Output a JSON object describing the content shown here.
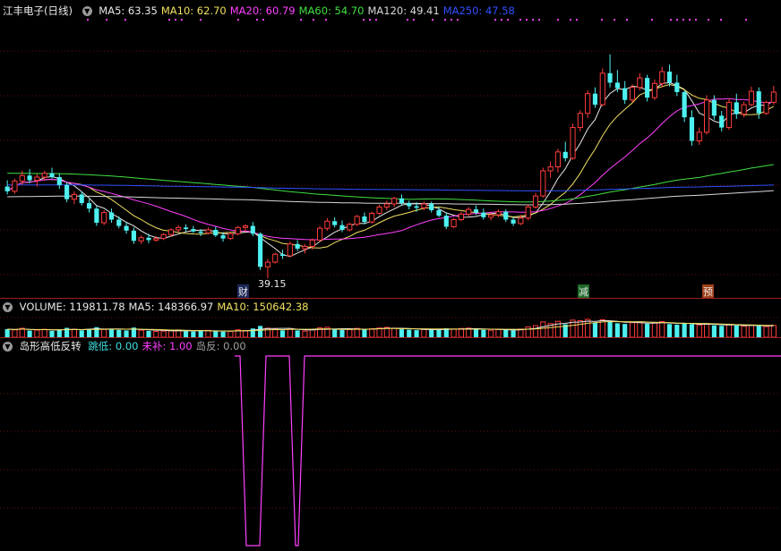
{
  "stock": {
    "name": "江丰电子",
    "period": "(日线)"
  },
  "price_legend": [
    {
      "label": "MA5:",
      "value": "63.35",
      "color": "#e8e8e8"
    },
    {
      "label": "MA10:",
      "value": "62.70",
      "color": "#f0e060"
    },
    {
      "label": "MA20:",
      "value": "60.79",
      "color": "#ff40ff"
    },
    {
      "label": "MA60:",
      "value": "54.70",
      "color": "#40e040"
    },
    {
      "label": "MA120:",
      "value": "49.41",
      "color": "#d8d8d8"
    },
    {
      "label": "MA250:",
      "value": "47.58",
      "color": "#3050ff"
    }
  ],
  "annotations": {
    "low_price": "39.15",
    "marker_cai": "财",
    "marker_jian": "减",
    "marker_yu": "预"
  },
  "volume_legend": [
    {
      "label": "VOLUME:",
      "value": "119811.78",
      "color": "#e8e8e8"
    },
    {
      "label": "MA5:",
      "value": "148366.97",
      "color": "#e8e8e8"
    },
    {
      "label": "MA10:",
      "value": "150642.38",
      "color": "#f0e060"
    }
  ],
  "indicator_legend": {
    "name": "岛形高低反转",
    "items": [
      {
        "label": "跳低:",
        "value": "0.00",
        "color": "#40e0e0"
      },
      {
        "label": "未补:",
        "value": "1.00",
        "color": "#ff40ff"
      },
      {
        "label": "岛反:",
        "value": "0.00",
        "color": "#a0a0a0"
      }
    ]
  },
  "colors": {
    "up": "#ff3c3c",
    "down": "#4ef0f0",
    "grid": "#6a1010",
    "panel_border": "#a02020"
  },
  "chart_data": [
    {
      "type": "candlestick",
      "title": "江丰电子 (日线)",
      "ylim": [
        37,
        72
      ],
      "series_names": [
        "MA5",
        "MA10",
        "MA20",
        "MA60",
        "MA120",
        "MA250"
      ],
      "candles": [
        [
          50.8,
          51.6,
          49.8,
          50.2
        ],
        [
          50.2,
          51.8,
          49.9,
          51.5
        ],
        [
          51.5,
          52.8,
          51.0,
          52.2
        ],
        [
          52.2,
          53.0,
          51.2,
          51.6
        ],
        [
          51.6,
          52.4,
          50.8,
          52.0
        ],
        [
          52.0,
          52.8,
          51.5,
          52.5
        ],
        [
          52.5,
          53.2,
          51.8,
          52.0
        ],
        [
          52.0,
          52.5,
          50.5,
          51.0
        ],
        [
          51.0,
          51.3,
          48.8,
          49.2
        ],
        [
          49.2,
          50.2,
          48.6,
          49.8
        ],
        [
          49.8,
          50.2,
          48.4,
          48.7
        ],
        [
          48.7,
          49.2,
          47.5,
          48.0
        ],
        [
          48.0,
          48.3,
          45.8,
          46.2
        ],
        [
          46.2,
          47.8,
          45.9,
          47.5
        ],
        [
          47.5,
          48.0,
          46.2,
          46.6
        ],
        [
          46.6,
          47.0,
          45.5,
          45.8
        ],
        [
          45.8,
          46.2,
          44.8,
          45.2
        ],
        [
          45.2,
          45.6,
          43.5,
          43.9
        ],
        [
          43.9,
          44.6,
          43.5,
          44.3
        ],
        [
          44.3,
          44.8,
          43.6,
          44.0
        ],
        [
          44.0,
          44.5,
          43.8,
          44.2
        ],
        [
          44.2,
          44.9,
          44.0,
          44.7
        ],
        [
          44.7,
          45.5,
          44.4,
          45.3
        ],
        [
          45.3,
          45.9,
          45.0,
          45.6
        ],
        [
          45.6,
          46.0,
          45.1,
          45.4
        ],
        [
          45.4,
          45.8,
          44.9,
          45.1
        ],
        [
          45.1,
          45.4,
          44.5,
          44.9
        ],
        [
          44.9,
          45.6,
          44.7,
          45.3
        ],
        [
          45.3,
          45.7,
          44.4,
          44.6
        ],
        [
          44.6,
          45.0,
          43.8,
          44.2
        ],
        [
          44.2,
          45.0,
          44.0,
          44.8
        ],
        [
          44.8,
          45.8,
          44.6,
          45.6
        ],
        [
          45.6,
          46.0,
          45.1,
          45.8
        ],
        [
          45.8,
          46.3,
          44.5,
          44.8
        ],
        [
          44.8,
          45.0,
          40.2,
          40.6
        ],
        [
          40.6,
          41.6,
          39.15,
          41.2
        ],
        [
          41.2,
          42.4,
          41.0,
          42.2
        ],
        [
          42.2,
          42.8,
          41.6,
          42.0
        ],
        [
          42.0,
          43.8,
          41.8,
          43.5
        ],
        [
          43.5,
          44.0,
          42.6,
          42.9
        ],
        [
          42.9,
          43.5,
          42.3,
          43.2
        ],
        [
          43.2,
          44.2,
          42.8,
          44.0
        ],
        [
          44.0,
          45.8,
          43.8,
          45.5
        ],
        [
          45.5,
          46.8,
          45.2,
          46.4
        ],
        [
          46.4,
          46.9,
          45.6,
          45.9
        ],
        [
          45.9,
          46.5,
          45.0,
          45.3
        ],
        [
          45.3,
          46.2,
          45.1,
          46.0
        ],
        [
          46.0,
          47.2,
          45.8,
          47.0
        ],
        [
          47.0,
          47.5,
          46.0,
          46.3
        ],
        [
          46.3,
          47.6,
          46.1,
          47.4
        ],
        [
          47.4,
          48.5,
          47.2,
          48.2
        ],
        [
          48.2,
          49.0,
          47.8,
          48.6
        ],
        [
          48.6,
          49.5,
          48.2,
          49.3
        ],
        [
          49.3,
          49.8,
          48.4,
          48.7
        ],
        [
          48.7,
          49.0,
          47.9,
          48.3
        ],
        [
          48.3,
          48.8,
          47.6,
          48.1
        ],
        [
          48.1,
          48.9,
          47.8,
          48.6
        ],
        [
          48.6,
          48.9,
          47.5,
          47.8
        ],
        [
          47.8,
          48.2,
          46.9,
          47.1
        ],
        [
          47.1,
          47.5,
          45.4,
          45.7
        ],
        [
          45.7,
          46.8,
          45.5,
          46.6
        ],
        [
          46.6,
          47.6,
          46.4,
          47.3
        ],
        [
          47.3,
          48.2,
          47.0,
          47.9
        ],
        [
          47.9,
          48.4,
          47.2,
          47.5
        ],
        [
          47.5,
          48.0,
          46.6,
          46.9
        ],
        [
          46.9,
          47.4,
          46.5,
          47.2
        ],
        [
          47.2,
          47.9,
          46.9,
          47.6
        ],
        [
          47.6,
          47.9,
          46.3,
          46.6
        ],
        [
          46.6,
          46.9,
          45.8,
          46.1
        ],
        [
          46.1,
          47.2,
          45.9,
          46.8
        ],
        [
          46.8,
          48.5,
          46.5,
          48.2
        ],
        [
          48.2,
          50.0,
          48.0,
          49.6
        ],
        [
          49.6,
          53.2,
          49.4,
          52.8
        ],
        [
          52.8,
          54.0,
          51.9,
          53.3
        ],
        [
          53.3,
          55.6,
          52.6,
          55.2
        ],
        [
          55.2,
          56.5,
          54.0,
          54.4
        ],
        [
          54.4,
          58.8,
          54.2,
          58.3
        ],
        [
          58.3,
          60.5,
          57.8,
          60.1
        ],
        [
          60.1,
          63.0,
          59.5,
          62.6
        ],
        [
          62.6,
          63.4,
          60.8,
          61.2
        ],
        [
          61.2,
          65.8,
          61.0,
          65.2
        ],
        [
          65.2,
          67.6,
          63.4,
          64.0
        ],
        [
          64.0,
          65.6,
          62.8,
          63.3
        ],
        [
          63.3,
          64.2,
          61.3,
          61.8
        ],
        [
          61.8,
          63.8,
          61.5,
          63.4
        ],
        [
          63.4,
          65.2,
          63.0,
          64.6
        ],
        [
          64.6,
          65.0,
          61.6,
          62.1
        ],
        [
          62.1,
          64.4,
          61.8,
          63.9
        ],
        [
          63.9,
          66.0,
          63.4,
          65.4
        ],
        [
          65.4,
          66.3,
          63.5,
          64.0
        ],
        [
          64.0,
          65.0,
          62.3,
          62.8
        ],
        [
          62.8,
          63.0,
          59.0,
          59.6
        ],
        [
          59.6,
          60.5,
          56.0,
          56.6
        ],
        [
          56.6,
          58.3,
          56.1,
          57.7
        ],
        [
          57.7,
          62.4,
          57.4,
          61.8
        ],
        [
          61.8,
          62.4,
          59.3,
          59.8
        ],
        [
          59.8,
          60.4,
          57.8,
          58.3
        ],
        [
          58.3,
          62.0,
          58.0,
          61.5
        ],
        [
          61.5,
          62.6,
          59.4,
          60.0
        ],
        [
          60.0,
          61.6,
          59.6,
          61.2
        ],
        [
          61.2,
          63.5,
          61.0,
          62.9
        ],
        [
          62.9,
          63.4,
          59.4,
          60.1
        ],
        [
          60.1,
          61.7,
          59.9,
          61.5
        ],
        [
          61.5,
          63.6,
          61.2,
          62.8
        ]
      ]
    },
    {
      "type": "bar",
      "title": "VOLUME",
      "values": [
        8.2,
        7.5,
        9.1,
        6.8,
        7.2,
        8.0,
        6.5,
        7.8,
        9.5,
        8.1,
        7.0,
        8.4,
        10.2,
        7.9,
        8.6,
        7.3,
        6.9,
        9.8,
        7.1,
        6.4,
        5.9,
        6.2,
        6.8,
        7.4,
        6.1,
        5.8,
        6.5,
        7.0,
        6.3,
        5.7,
        6.0,
        7.5,
        6.8,
        8.9,
        11.5,
        9.2,
        8.4,
        7.0,
        8.8,
        6.9,
        6.2,
        7.9,
        9.6,
        10.1,
        8.2,
        7.4,
        7.8,
        9.0,
        8.3,
        8.7,
        9.4,
        10.0,
        9.2,
        8.1,
        7.6,
        7.2,
        7.9,
        8.0,
        7.4,
        9.1,
        8.4,
        8.9,
        9.3,
        8.0,
        7.5,
        7.1,
        7.8,
        7.6,
        7.0,
        8.3,
        10.5,
        11.8,
        15.6,
        13.9,
        16.2,
        13.1,
        17.4,
        16.8,
        18.2,
        14.5,
        17.9,
        16.1,
        14.2,
        13.5,
        14.8,
        15.3,
        13.7,
        14.6,
        15.9,
        13.4,
        12.8,
        14.1,
        13.2,
        12.5,
        13.9,
        12.1,
        11.6,
        12.8,
        11.9,
        11.2,
        12.3,
        11.4,
        10.8,
        11.98
      ]
    },
    {
      "type": "line",
      "title": "岛形高低反转",
      "ylim": [
        0,
        1
      ],
      "series_names": [
        "未补"
      ],
      "values_ones": [
        1
      ]
    }
  ]
}
